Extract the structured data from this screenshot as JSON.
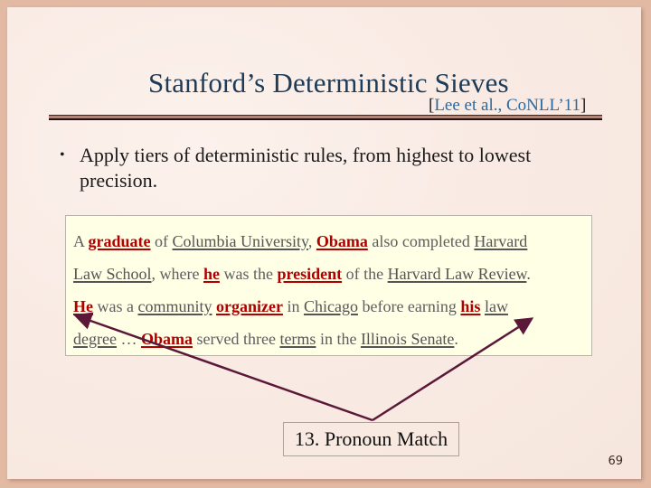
{
  "slide": {
    "title": "Stanford’s Deterministic Sieves",
    "citation": {
      "open_bracket": "[",
      "text": "Lee et al., CoNLL’11",
      "close_bracket": "]"
    },
    "bullets": [
      {
        "marker": "•",
        "text": "Apply tiers of deterministic rules, from highest to lowest precision."
      }
    ],
    "example": {
      "lines": [
        [
          {
            "t": "A ",
            "k": "plain"
          },
          {
            "t": "graduate",
            "k": "pronoun-cluster"
          },
          {
            "t": " of ",
            "k": "plain"
          },
          {
            "t": "Columbia University",
            "k": "mention"
          },
          {
            "t": ", ",
            "k": "plain"
          },
          {
            "t": "Obama",
            "k": "pronoun-cluster"
          },
          {
            "t": " also completed ",
            "k": "plain"
          },
          {
            "t": "Harvard",
            "k": "mention"
          }
        ],
        [
          {
            "t": "Law School",
            "k": "mention"
          },
          {
            "t": ", where ",
            "k": "plain"
          },
          {
            "t": "he",
            "k": "pronoun-cluster"
          },
          {
            "t": " was the ",
            "k": "plain"
          },
          {
            "t": "president",
            "k": "pronoun-cluster"
          },
          {
            "t": " of the ",
            "k": "plain"
          },
          {
            "t": "Harvard Law Review",
            "k": "mention"
          },
          {
            "t": ".",
            "k": "plain"
          }
        ],
        [
          {
            "t": "He",
            "k": "pronoun-cluster"
          },
          {
            "t": " was a ",
            "k": "plain"
          },
          {
            "t": "community",
            "k": "mention"
          },
          {
            "t": "  ",
            "k": "plain"
          },
          {
            "t": "organizer",
            "k": "pronoun-cluster"
          },
          {
            "t": " in ",
            "k": "plain"
          },
          {
            "t": "Chicago",
            "k": "mention"
          },
          {
            "t": " before earning ",
            "k": "plain"
          },
          {
            "t": "his",
            "k": "pronoun-cluster"
          },
          {
            "t": "  ",
            "k": "plain"
          },
          {
            "t": "law",
            "k": "mention"
          }
        ],
        [
          {
            "t": "degree",
            "k": "mention"
          },
          {
            "t": " … ",
            "k": "plain"
          },
          {
            "t": "Obama",
            "k": "pronoun-cluster"
          },
          {
            "t": " served three ",
            "k": "plain"
          },
          {
            "t": "terms",
            "k": "mention"
          },
          {
            "t": " in the ",
            "k": "plain"
          },
          {
            "t": "Illinois Senate",
            "k": "mention"
          },
          {
            "t": ".",
            "k": "plain"
          }
        ]
      ]
    },
    "sieve_label": "13. Pronoun Match",
    "arrow_targets": [
      "He",
      "his"
    ],
    "page_number": "69",
    "colors": {
      "title": "#1f3b55",
      "citation": "#2a6aa0",
      "highlight": "#b00000",
      "arrow": "#5b1838",
      "frame": "#e2b9a3",
      "example_bg": "#ffffe6"
    }
  }
}
